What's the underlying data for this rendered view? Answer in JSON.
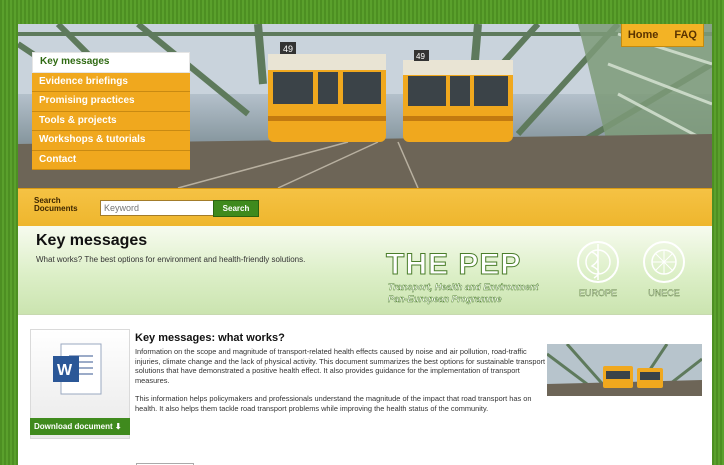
{
  "top_nav": {
    "home": "Home",
    "faq": "FAQ"
  },
  "side_nav": [
    {
      "label": "Key messages",
      "active": true
    },
    {
      "label": "Evidence briefings",
      "active": false
    },
    {
      "label": "Promising practices",
      "active": false
    },
    {
      "label": "Tools & projects",
      "active": false
    },
    {
      "label": "Workshops & tutorials",
      "active": false
    },
    {
      "label": "Contact",
      "active": false
    }
  ],
  "search": {
    "label_line1": "Search",
    "label_line2": "Documents",
    "placeholder": "Keyword",
    "button": "Search"
  },
  "banner": {
    "title": "Key messages",
    "subtitle": "What works? The best options for environment and health-friendly solutions.",
    "pep_title": "THE PEP",
    "pep_line1": "Transport, Health and Environment",
    "pep_line2": "Pan-European Programme",
    "emblem_left": "EUROPE",
    "emblem_right": "UNECE"
  },
  "tram_numbers": [
    "49",
    "49"
  ],
  "article": {
    "heading": "Key messages: what works?",
    "para1": "Information on the scope and magnitude of transport-related health effects caused by noise and air pollution, road-traffic injuries, climate change and the lack of physical activity. This document summarizes the best options for sustainable transport solutions that have demonstrated a positive health effect. It also provides guidance for the implementation of transport measures.",
    "para2": "This information helps policymakers and professionals understand the magnitude of the impact that road transport has on health. It also helps them tackle road transport problems while improving the health status of the community."
  },
  "download": {
    "label": "Download document",
    "icon": "arrow-down-icon"
  },
  "colors": {
    "green": "#3f8a1d",
    "orange": "#f0a81e",
    "yellow": "#f5c244"
  }
}
